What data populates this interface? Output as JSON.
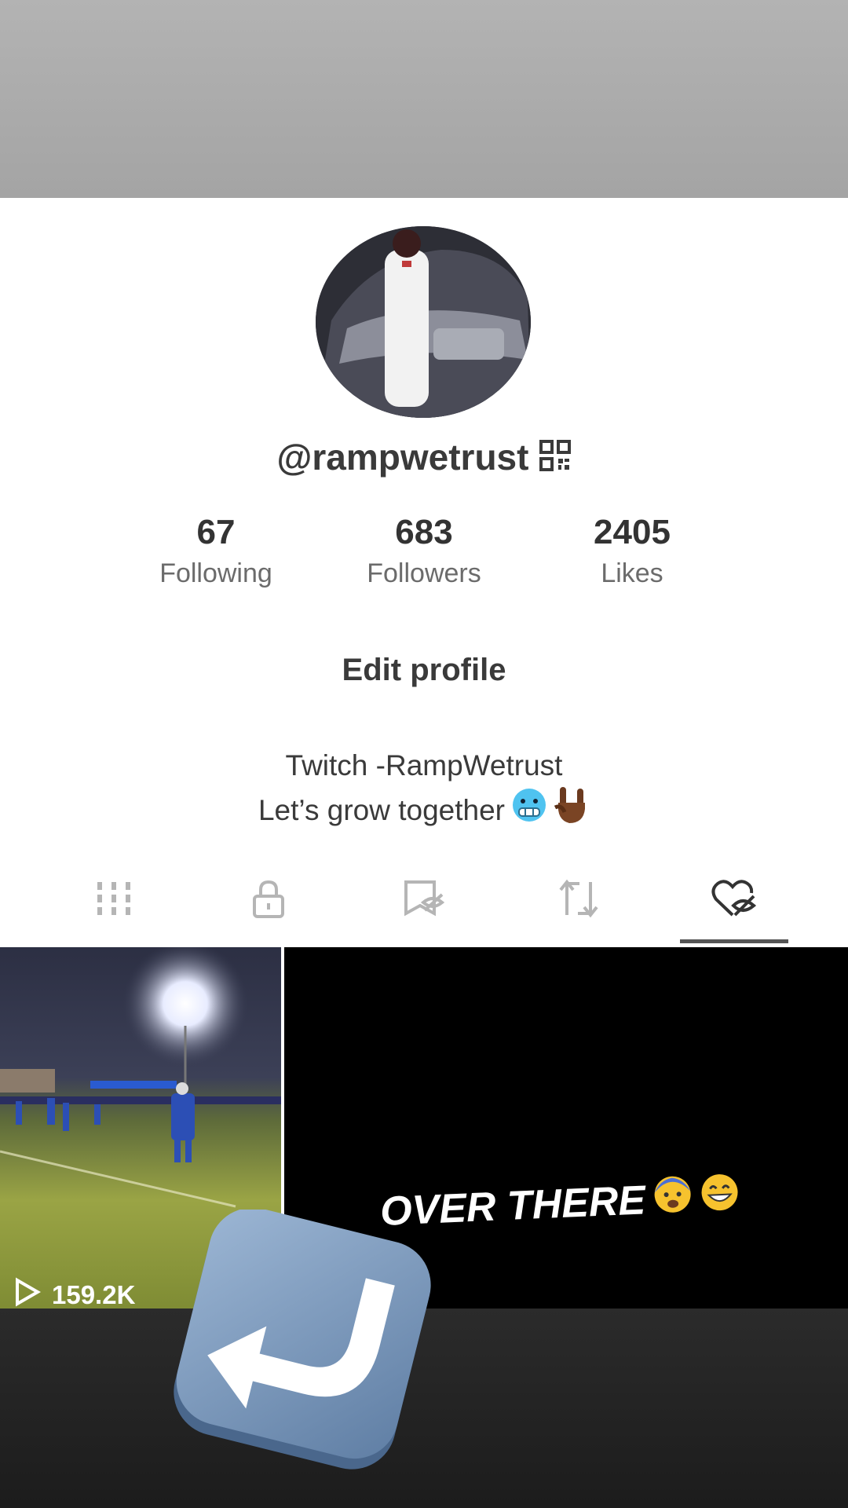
{
  "profile": {
    "username": "@rampwetrust",
    "stats": [
      {
        "value": "67",
        "label": "Following"
      },
      {
        "value": "683",
        "label": "Followers"
      },
      {
        "value": "2405",
        "label": "Likes"
      }
    ],
    "edit_button": "Edit profile",
    "bio_line1": "Twitch -RampWetrust",
    "bio_line2": "Let’s grow together"
  },
  "tabs": [
    {
      "icon": "grid-icon"
    },
    {
      "icon": "lock-icon"
    },
    {
      "icon": "hidden-tag-icon"
    },
    {
      "icon": "repost-icon"
    },
    {
      "icon": "hidden-heart-icon",
      "active": true
    }
  ],
  "videos": [
    {
      "views": "159.2K"
    },
    {
      "caption": "OVER THERE"
    }
  ],
  "colors": {
    "accent_underline": "#555555",
    "text": "#3a3a3a"
  }
}
